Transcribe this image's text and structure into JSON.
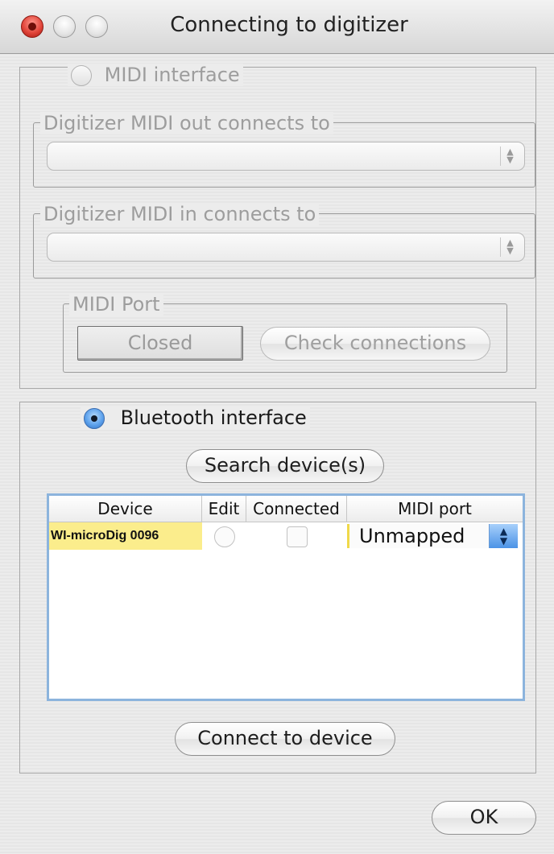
{
  "window": {
    "title": "Connecting to digitizer"
  },
  "midi": {
    "interface_label": "MIDI interface",
    "out_group_label": "Digitizer MIDI out connects to",
    "out_value": "",
    "in_group_label": "Digitizer MIDI in connects to",
    "in_value": "",
    "port_group_label": "MIDI Port",
    "port_button_label": "Closed",
    "check_button_label": "Check connections"
  },
  "bluetooth": {
    "interface_label": "Bluetooth interface",
    "search_button_label": "Search device(s)",
    "table": {
      "columns": [
        "Device",
        "Edit",
        "Connected",
        "MIDI port"
      ],
      "rows": [
        {
          "device": "WI-microDig 0096",
          "edit": false,
          "connected": false,
          "midi_port": "Unmapped"
        }
      ]
    },
    "connect_button_label": "Connect to device"
  },
  "ok_button_label": "OK",
  "colors": {
    "selected_row_highlight": "#fbed8c",
    "table_focus_border": "#8cb4dd",
    "close_button": "#e2463b"
  }
}
